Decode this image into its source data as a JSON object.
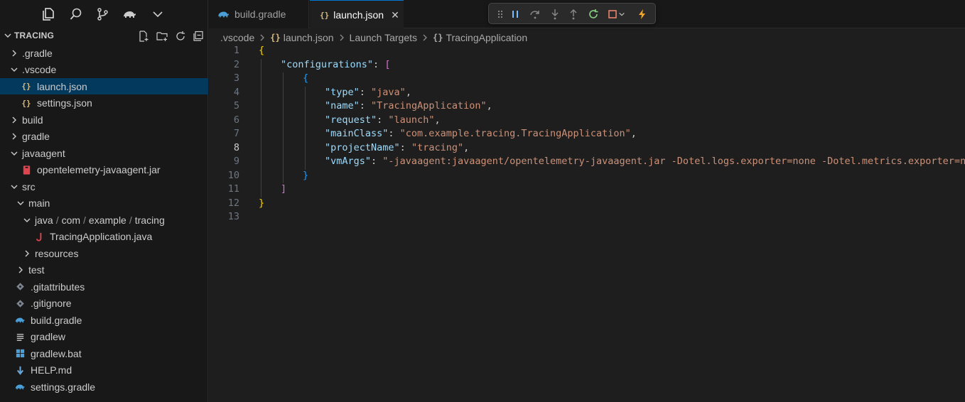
{
  "sidebar": {
    "title": "TRACING",
    "tree": [
      {
        "label": ".gradle",
        "icon": "chevron-right",
        "depth": 1
      },
      {
        "label": ".vscode",
        "icon": "chevron-down",
        "depth": 1
      },
      {
        "label": "launch.json",
        "icon": "json-file",
        "depth": 2,
        "selected": true
      },
      {
        "label": "settings.json",
        "icon": "json-file",
        "depth": 2
      },
      {
        "label": "build",
        "icon": "chevron-right",
        "depth": 1
      },
      {
        "label": "gradle",
        "icon": "chevron-right",
        "depth": 1
      },
      {
        "label": "javaagent",
        "icon": "chevron-down",
        "depth": 1
      },
      {
        "label": "opentelemetry-javaagent.jar",
        "icon": "jar-file",
        "depth": 2
      },
      {
        "label": "src",
        "icon": "chevron-down",
        "depth": 1
      },
      {
        "label": "main",
        "icon": "chevron-down",
        "depth": 2
      },
      {
        "label": "tracing",
        "icon": "chevron-down",
        "depth": 3,
        "path": [
          "java",
          "com",
          "example",
          "tracing"
        ]
      },
      {
        "label": "TracingApplication.java",
        "icon": "java-file",
        "depth": 4
      },
      {
        "label": "resources",
        "icon": "chevron-right",
        "depth": 3
      },
      {
        "label": "test",
        "icon": "chevron-right",
        "depth": 2
      },
      {
        "label": ".gitattributes",
        "icon": "git-file",
        "depth": 1
      },
      {
        "label": ".gitignore",
        "icon": "git-file",
        "depth": 1
      },
      {
        "label": "build.gradle",
        "icon": "gradle-file",
        "depth": 1
      },
      {
        "label": "gradlew",
        "icon": "lines-file",
        "depth": 1
      },
      {
        "label": "gradlew.bat",
        "icon": "windows-file",
        "depth": 1
      },
      {
        "label": "HELP.md",
        "icon": "markdown-file",
        "depth": 1
      },
      {
        "label": "settings.gradle",
        "icon": "gradle-file",
        "depth": 1
      }
    ]
  },
  "tabs": [
    {
      "label": "build.gradle",
      "icon": "gradle-icon",
      "active": false
    },
    {
      "label": "launch.json",
      "icon": "json-icon",
      "active": true,
      "close": "✕"
    }
  ],
  "json_icon_glyph": "{}",
  "breadcrumb": [
    ".vscode",
    "launch.json",
    "Launch Targets",
    "TracingApplication"
  ],
  "code": {
    "current_line": 8,
    "lines": [
      {
        "n": "1",
        "indent": 0,
        "parts": [
          {
            "t": "{",
            "c": "b1"
          }
        ]
      },
      {
        "n": "2",
        "indent": 1,
        "parts": [
          {
            "t": "\"configurations\"",
            "c": "key"
          },
          {
            "t": ": ",
            "c": "p"
          },
          {
            "t": "[",
            "c": "b2"
          }
        ]
      },
      {
        "n": "3",
        "indent": 2,
        "parts": [
          {
            "t": "{",
            "c": "b3"
          }
        ]
      },
      {
        "n": "4",
        "indent": 3,
        "parts": [
          {
            "t": "\"type\"",
            "c": "key"
          },
          {
            "t": ": ",
            "c": "p"
          },
          {
            "t": "\"java\"",
            "c": "str"
          },
          {
            "t": ",",
            "c": "p"
          }
        ]
      },
      {
        "n": "5",
        "indent": 3,
        "parts": [
          {
            "t": "\"name\"",
            "c": "key"
          },
          {
            "t": ": ",
            "c": "p"
          },
          {
            "t": "\"TracingApplication\"",
            "c": "str"
          },
          {
            "t": ",",
            "c": "p"
          }
        ]
      },
      {
        "n": "6",
        "indent": 3,
        "parts": [
          {
            "t": "\"request\"",
            "c": "key"
          },
          {
            "t": ": ",
            "c": "p"
          },
          {
            "t": "\"launch\"",
            "c": "str"
          },
          {
            "t": ",",
            "c": "p"
          }
        ]
      },
      {
        "n": "7",
        "indent": 3,
        "parts": [
          {
            "t": "\"mainClass\"",
            "c": "key"
          },
          {
            "t": ": ",
            "c": "p"
          },
          {
            "t": "\"com.example.tracing.TracingApplication\"",
            "c": "str"
          },
          {
            "t": ",",
            "c": "p"
          }
        ]
      },
      {
        "n": "8",
        "indent": 3,
        "parts": [
          {
            "t": "\"projectName\"",
            "c": "key"
          },
          {
            "t": ": ",
            "c": "p"
          },
          {
            "t": "\"tracing\"",
            "c": "str"
          },
          {
            "t": ",",
            "c": "p"
          }
        ]
      },
      {
        "n": "9",
        "indent": 3,
        "parts": [
          {
            "t": "\"vmArgs\"",
            "c": "key"
          },
          {
            "t": ": ",
            "c": "p"
          },
          {
            "t": "\"-javaagent:javaagent/opentelemetry-javaagent.jar -Dotel.logs.exporter=none -Dotel.metrics.exporter=none\"",
            "c": "str"
          },
          {
            "t": ",",
            "c": "p"
          }
        ]
      },
      {
        "n": "10",
        "indent": 2,
        "parts": [
          {
            "t": "}",
            "c": "b3"
          }
        ]
      },
      {
        "n": "11",
        "indent": 1,
        "parts": [
          {
            "t": "]",
            "c": "b2"
          }
        ]
      },
      {
        "n": "12",
        "indent": 0,
        "parts": [
          {
            "t": "}",
            "c": "b1"
          }
        ]
      },
      {
        "n": "13",
        "indent": 0,
        "parts": []
      }
    ]
  },
  "colors": {
    "accent": "#0078d4",
    "selection": "#04395e",
    "json_key": "#9cdcfe",
    "json_string": "#ce9178",
    "bracket_1": "#ffd700",
    "bracket_2": "#da70d6",
    "bracket_3": "#179fff"
  }
}
